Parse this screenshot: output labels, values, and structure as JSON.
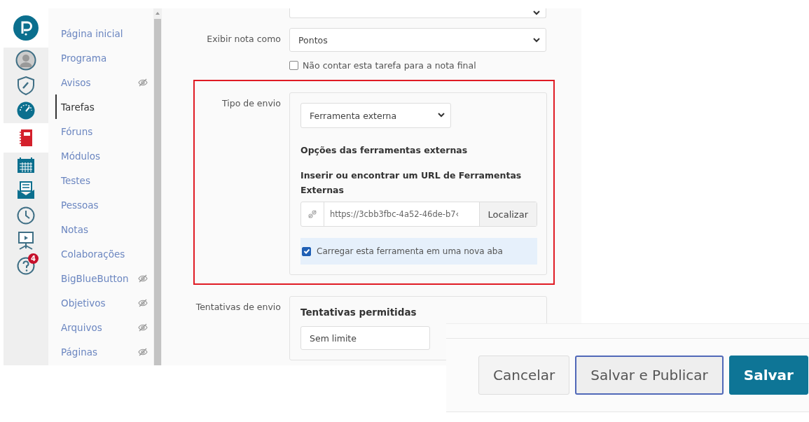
{
  "global_nav": [
    {
      "kind": "account",
      "selected": false
    },
    {
      "kind": "admin",
      "selected": false
    },
    {
      "kind": "dashboard",
      "selected": false
    },
    {
      "kind": "courses",
      "selected": true
    },
    {
      "kind": "calendar",
      "selected": false
    },
    {
      "kind": "inbox",
      "selected": false
    },
    {
      "kind": "history",
      "selected": false
    },
    {
      "kind": "studio",
      "selected": false
    },
    {
      "kind": "help",
      "selected": false,
      "badge": "4"
    }
  ],
  "course_nav": [
    {
      "label": "Página inicial",
      "selected": false,
      "hidden": false
    },
    {
      "label": "Programa",
      "selected": false,
      "hidden": false
    },
    {
      "label": "Avisos",
      "selected": false,
      "hidden": true
    },
    {
      "label": "Tarefas",
      "selected": true,
      "hidden": false
    },
    {
      "label": "Fóruns",
      "selected": false,
      "hidden": false
    },
    {
      "label": "Módulos",
      "selected": false,
      "hidden": false
    },
    {
      "label": "Testes",
      "selected": false,
      "hidden": false
    },
    {
      "label": "Pessoas",
      "selected": false,
      "hidden": false
    },
    {
      "label": "Notas",
      "selected": false,
      "hidden": false
    },
    {
      "label": "Colaborações",
      "selected": false,
      "hidden": false
    },
    {
      "label": "BigBlueButton",
      "selected": false,
      "hidden": true
    },
    {
      "label": "Objetivos",
      "selected": false,
      "hidden": true
    },
    {
      "label": "Arquivos",
      "selected": false,
      "hidden": true
    },
    {
      "label": "Páginas",
      "selected": false,
      "hidden": true
    }
  ],
  "form": {
    "grade_display": {
      "label": "Exibir nota como",
      "value": "Pontos"
    },
    "exclude_final": {
      "label": "Não contar esta tarefa para a nota final",
      "checked": false
    },
    "submission_type": {
      "label": "Tipo de envio",
      "value": "Ferramenta externa",
      "options_heading": "Opções das ferramentas externas",
      "url_label": "Inserir ou encontrar um URL de Ferramentas Externas",
      "url_value": "https://3cbb3fbc-4a52-46de-b7‹",
      "find_button": "Localizar",
      "new_tab": {
        "label": "Carregar esta ferramenta em uma nova aba",
        "checked": true
      }
    },
    "attempts": {
      "label": "Tentativas de envio",
      "heading": "Tentativas permitidas",
      "value": "Sem limite"
    }
  },
  "footer_buttons": [
    {
      "label": "Cancelar",
      "kind": "default"
    },
    {
      "label": "Salvar e Publicar",
      "kind": "focused"
    },
    {
      "label": "Salvar",
      "kind": "primary"
    }
  ]
}
